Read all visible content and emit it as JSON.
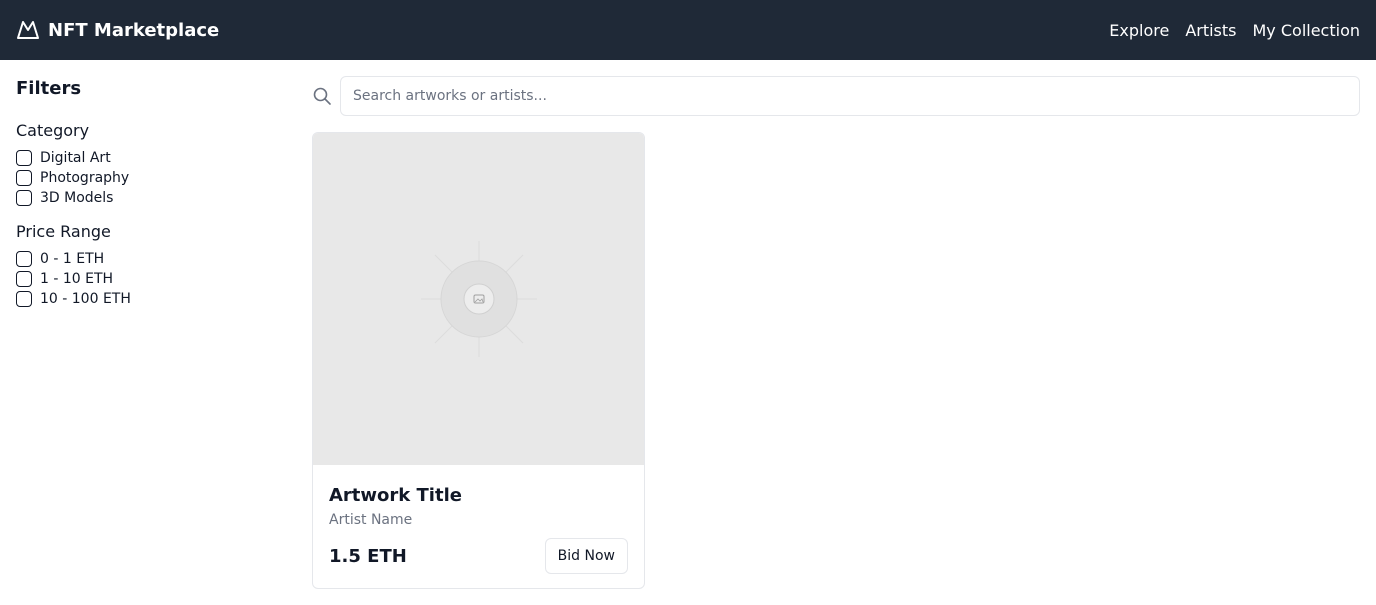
{
  "header": {
    "brand_title": "NFT Marketplace",
    "logo_icon": "mountain-icon",
    "nav": [
      {
        "label": "Explore"
      },
      {
        "label": "Artists"
      },
      {
        "label": "My Collection"
      }
    ]
  },
  "sidebar": {
    "title": "Filters",
    "groups": [
      {
        "title": "Category",
        "options": [
          {
            "label": "Digital Art"
          },
          {
            "label": "Photography"
          },
          {
            "label": "3D Models"
          }
        ]
      },
      {
        "title": "Price Range",
        "options": [
          {
            "label": "0 - 1 ETH"
          },
          {
            "label": "1 - 10 ETH"
          },
          {
            "label": "10 - 100 ETH"
          }
        ]
      }
    ]
  },
  "search": {
    "placeholder": "Search artworks or artists...",
    "value": "",
    "icon": "search-icon"
  },
  "cards": [
    {
      "title": "Artwork Title",
      "artist": "Artist Name",
      "price": "1.5 ETH",
      "button_label": "Bid Now",
      "image_icon": "image-placeholder-icon"
    }
  ],
  "colors": {
    "header_bg": "#1f2937",
    "placeholder_bg": "#e8e8e8",
    "muted_text": "#6b7280",
    "border": "#e5e7eb"
  }
}
